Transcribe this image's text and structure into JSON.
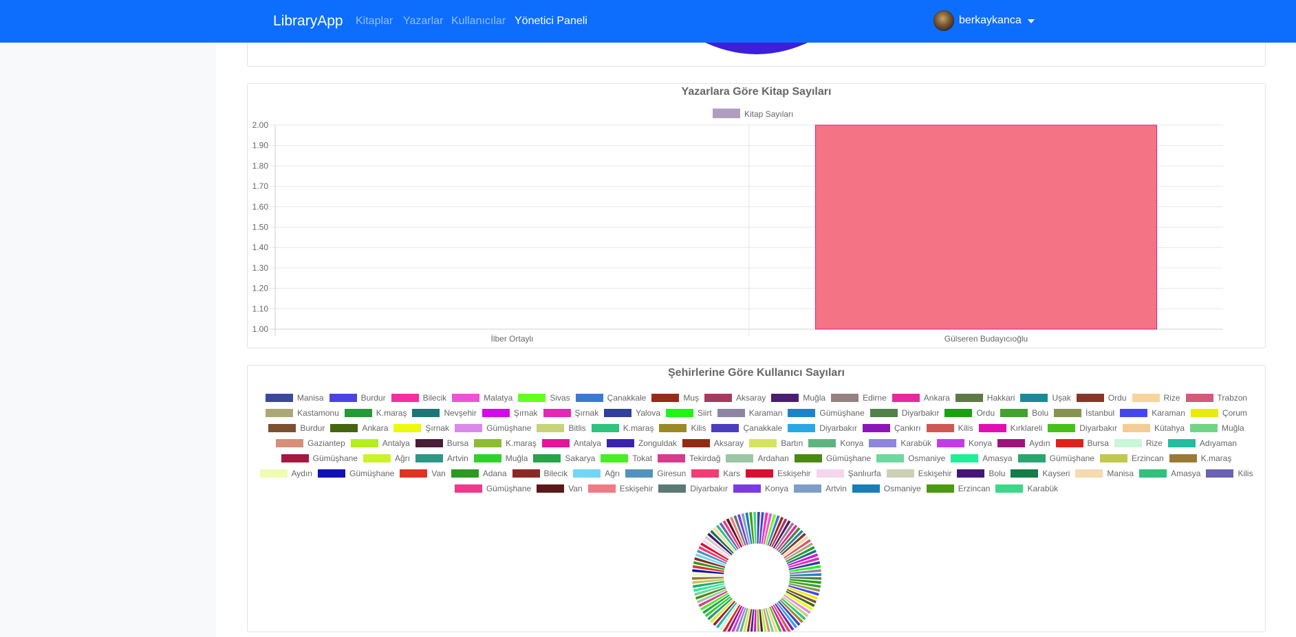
{
  "navbar": {
    "brand": "LibraryApp",
    "links": [
      {
        "label": "Kitaplar",
        "active": false
      },
      {
        "label": "Yazarlar",
        "active": false
      },
      {
        "label": "Kullanıcılar",
        "active": false
      },
      {
        "label": "Yönetici Paneli",
        "active": true
      }
    ],
    "user": {
      "name": "berkaykanca",
      "avatar_icon": "user-avatar",
      "menu_icon": "caret-down-icon"
    },
    "background_color": "#0d6efd"
  },
  "charts": {
    "books_by_author": {
      "title": "Yazarlara Göre Kitap Sayıları",
      "legend_label": "Kitap Sayıları",
      "legend_color": "#b19ebf"
    },
    "users_by_city": {
      "title": "Şehirlerine Göre Kullanıcı Sayıları"
    }
  },
  "chart_data": [
    {
      "type": "pie",
      "partially_visible": true,
      "color": "#3c1fd9",
      "note": "bottom of a previous chart, scrolled off top"
    },
    {
      "type": "bar",
      "title": "Yazarlara Göre Kitap Sayıları",
      "categories": [
        "İlber Ortaylı",
        "Gülseren Budayıcıoğlu"
      ],
      "series": [
        {
          "name": "Kitap Sayıları",
          "values": [
            1,
            2
          ],
          "colors": [
            "#f47384",
            "#f47384"
          ],
          "border_color": "#e0218a"
        }
      ],
      "ylim": [
        1.0,
        2.0
      ],
      "yticks": [
        "1.00",
        "1.10",
        "1.20",
        "1.30",
        "1.40",
        "1.50",
        "1.60",
        "1.70",
        "1.80",
        "1.90",
        "2.00"
      ],
      "grid": true,
      "legend": "top"
    },
    {
      "type": "pie",
      "style": "doughnut",
      "title": "Şehirlerine Göre Kullanıcı Sayıları",
      "legend": "top",
      "categories": [
        {
          "label": "Manisa",
          "color": "#3c479e"
        },
        {
          "label": "Burdur",
          "color": "#4a44e0"
        },
        {
          "label": "Bilecik",
          "color": "#f52fa0"
        },
        {
          "label": "Malatya",
          "color": "#f052d6"
        },
        {
          "label": "Sivas",
          "color": "#66ff22"
        },
        {
          "label": "Çanakkale",
          "color": "#3a7ad6"
        },
        {
          "label": "Muş",
          "color": "#9a2a18"
        },
        {
          "label": "Aksaray",
          "color": "#a73a5e"
        },
        {
          "label": "Muğla",
          "color": "#4a1e72"
        },
        {
          "label": "Edirne",
          "color": "#968080"
        },
        {
          "label": "Ankara",
          "color": "#e42a9e"
        },
        {
          "label": "Hakkari",
          "color": "#5d7a45"
        },
        {
          "label": "Uşak",
          "color": "#198a99"
        },
        {
          "label": "Ordu",
          "color": "#873629"
        },
        {
          "label": "Rize",
          "color": "#f8d49a"
        },
        {
          "label": "Trabzon",
          "color": "#d9577a"
        },
        {
          "label": "Kastamonu",
          "color": "#aaa876"
        },
        {
          "label": "K.maraş",
          "color": "#229a35"
        },
        {
          "label": "Nevşehir",
          "color": "#1c7576"
        },
        {
          "label": "Şırnak",
          "color": "#d20ce8"
        },
        {
          "label": "Şırnak",
          "color": "#e02ab4"
        },
        {
          "label": "Yalova",
          "color": "#2f3f9a"
        },
        {
          "label": "Siirt",
          "color": "#1cf719"
        },
        {
          "label": "Karaman",
          "color": "#8d85a3"
        },
        {
          "label": "Gümüşhane",
          "color": "#1f83c8"
        },
        {
          "label": "Diyarbakır",
          "color": "#4f8248"
        },
        {
          "label": "Ordu",
          "color": "#1ba012"
        },
        {
          "label": "Bolu",
          "color": "#42a22d"
        },
        {
          "label": "İstanbul",
          "color": "#87934f"
        },
        {
          "label": "Karaman",
          "color": "#4447f0"
        },
        {
          "label": "Çorum",
          "color": "#e9ec0b"
        },
        {
          "label": "Burdur",
          "color": "#7c5030"
        },
        {
          "label": "Ankara",
          "color": "#43660f"
        },
        {
          "label": "Şırnak",
          "color": "#ecfa0c"
        },
        {
          "label": "Gümüşhane",
          "color": "#dc89ec"
        },
        {
          "label": "Bitlis",
          "color": "#c9d17a"
        },
        {
          "label": "K.maraş",
          "color": "#2ec47e"
        },
        {
          "label": "Kilis",
          "color": "#9a8a25"
        },
        {
          "label": "Çanakkale",
          "color": "#4b3dbf"
        },
        {
          "label": "Diyarbakır",
          "color": "#28a9e6"
        },
        {
          "label": "Çankırı",
          "color": "#8c16b8"
        },
        {
          "label": "Kilis",
          "color": "#d05753"
        },
        {
          "label": "Kırklareli",
          "color": "#e20eb1"
        },
        {
          "label": "Diyarbakır",
          "color": "#47c11a"
        },
        {
          "label": "Kütahya",
          "color": "#f5cc95"
        },
        {
          "label": "Muğla",
          "color": "#71d585"
        },
        {
          "label": "Gaziantep",
          "color": "#d88f77"
        },
        {
          "label": "Antalya",
          "color": "#b4ee20"
        },
        {
          "label": "Bursa",
          "color": "#4a1c35"
        },
        {
          "label": "K.maraş",
          "color": "#8cbd2f"
        },
        {
          "label": "Antalya",
          "color": "#e31598"
        },
        {
          "label": "Zonguldak",
          "color": "#3a22b0"
        },
        {
          "label": "Aksaray",
          "color": "#922b14"
        },
        {
          "label": "Bartın",
          "color": "#d5e35d"
        },
        {
          "label": "Konya",
          "color": "#5eb480"
        },
        {
          "label": "Karabük",
          "color": "#8d86de"
        },
        {
          "label": "Konya",
          "color": "#c43ae8"
        },
        {
          "label": "Aydın",
          "color": "#9c1479"
        },
        {
          "label": "Bursa",
          "color": "#df2219"
        },
        {
          "label": "Rize",
          "color": "#c9f6d6"
        },
        {
          "label": "Adıyaman",
          "color": "#1fbfa0"
        },
        {
          "label": "Gümüşhane",
          "color": "#a51840"
        },
        {
          "label": "Ağrı",
          "color": "#cbf22c"
        },
        {
          "label": "Artvin",
          "color": "#2d9685"
        },
        {
          "label": "Muğla",
          "color": "#2fd22a"
        },
        {
          "label": "Sakarya",
          "color": "#26a448"
        },
        {
          "label": "Tokat",
          "color": "#4aee23"
        },
        {
          "label": "Tekirdağ",
          "color": "#d63c8c"
        },
        {
          "label": "Ardahan",
          "color": "#9ac6a4"
        },
        {
          "label": "Gümüşhane",
          "color": "#4a8a12"
        },
        {
          "label": "Osmaniye",
          "color": "#6ed89e"
        },
        {
          "label": "Amasya",
          "color": "#22ee98"
        },
        {
          "label": "Gümüşhane",
          "color": "#2aa56e"
        },
        {
          "label": "Erzincan",
          "color": "#c1c84d"
        },
        {
          "label": "K.maraş",
          "color": "#9b7a36"
        },
        {
          "label": "Aydın",
          "color": "#effcb2"
        },
        {
          "label": "Gümüşhane",
          "color": "#1212b4"
        },
        {
          "label": "Van",
          "color": "#df3424"
        },
        {
          "label": "Adana",
          "color": "#2c9a22"
        },
        {
          "label": "Bilecik",
          "color": "#8b2a24"
        },
        {
          "label": "Ağrı",
          "color": "#70d6f6"
        },
        {
          "label": "Giresun",
          "color": "#5094be"
        },
        {
          "label": "Kars",
          "color": "#f33b74"
        },
        {
          "label": "Eskişehir",
          "color": "#d80f2f"
        },
        {
          "label": "Şanlıurfa",
          "color": "#f4d6ee"
        },
        {
          "label": "Eskişehir",
          "color": "#cdd0b4"
        },
        {
          "label": "Bolu",
          "color": "#461577"
        },
        {
          "label": "Kayseri",
          "color": "#147c48"
        },
        {
          "label": "Manisa",
          "color": "#f6d9ae"
        },
        {
          "label": "Amasya",
          "color": "#32c07c"
        },
        {
          "label": "Kilis",
          "color": "#6a62b2"
        },
        {
          "label": "Gümüşhane",
          "color": "#f2388c"
        },
        {
          "label": "Van",
          "color": "#5a1818"
        },
        {
          "label": "Eskişehir",
          "color": "#f07b84"
        },
        {
          "label": "Diyarbakır",
          "color": "#5a7a78"
        },
        {
          "label": "Konya",
          "color": "#7a3ae6"
        },
        {
          "label": "Artvin",
          "color": "#7e9ec8"
        },
        {
          "label": "Osmaniye",
          "color": "#187eb4"
        },
        {
          "label": "Erzincan",
          "color": "#4a9a12"
        },
        {
          "label": "Karabük",
          "color": "#3ad88a"
        }
      ]
    }
  ]
}
